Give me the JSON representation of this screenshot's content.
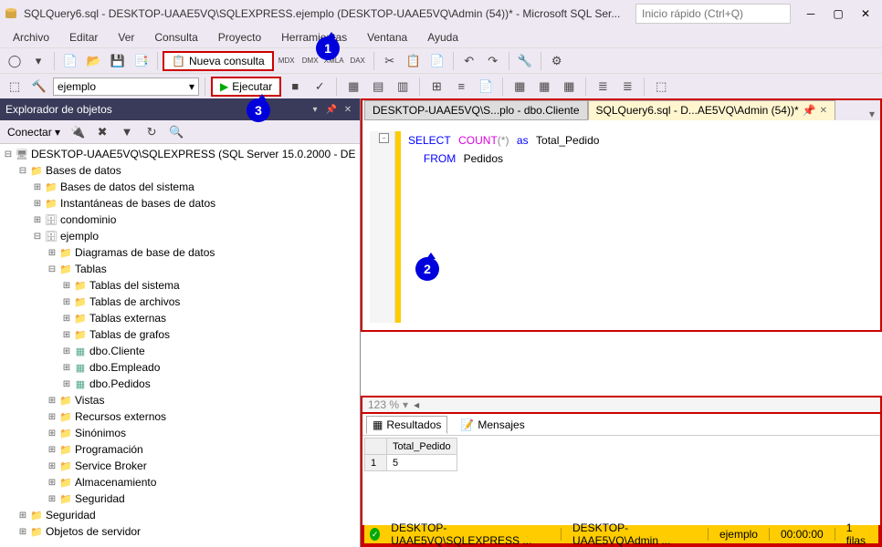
{
  "title": "SQLQuery6.sql - DESKTOP-UAAE5VQ\\SQLEXPRESS.ejemplo (DESKTOP-UAAE5VQ\\Admin (54))* - Microsoft SQL Ser...",
  "quick_launch_placeholder": "Inicio rápido (Ctrl+Q)",
  "menu": [
    "Archivo",
    "Editar",
    "Ver",
    "Consulta",
    "Proyecto",
    "Herramientas",
    "Ventana",
    "Ayuda"
  ],
  "toolbar1": {
    "nueva_consulta": "Nueva consulta"
  },
  "toolbar2": {
    "db": "ejemplo",
    "ejecutar": "Ejecutar"
  },
  "explorer": {
    "title": "Explorador de objetos",
    "conectar": "Conectar",
    "server": "DESKTOP-UAAE5VQ\\SQLEXPRESS (SQL Server 15.0.2000 - DE",
    "nodes": {
      "bases_de_datos": "Bases de datos",
      "bd_sistema": "Bases de datos del sistema",
      "instantaneas": "Instantáneas de bases de datos",
      "condominio": "condominio",
      "ejemplo": "ejemplo",
      "diagramas": "Diagramas de base de datos",
      "tablas": "Tablas",
      "tablas_sistema": "Tablas del sistema",
      "tablas_archivos": "Tablas de archivos",
      "tablas_externas": "Tablas externas",
      "tablas_grafos": "Tablas de grafos",
      "dbo_cliente": "dbo.Cliente",
      "dbo_empleado": "dbo.Empleado",
      "dbo_pedidos": "dbo.Pedidos",
      "vistas": "Vistas",
      "recursos_externos": "Recursos externos",
      "sinonimos": "Sinónimos",
      "programacion": "Programación",
      "service_broker": "Service Broker",
      "almacenamiento": "Almacenamiento",
      "seguridad": "Seguridad",
      "seguridad2": "Seguridad",
      "objetos_servidor": "Objetos de servidor"
    }
  },
  "tabs": {
    "inactive": "DESKTOP-UAAE5VQ\\S...plo - dbo.Cliente",
    "active": "SQLQuery6.sql - D...AE5VQ\\Admin (54))*"
  },
  "sql": {
    "line1_a": "SELECT",
    "line1_b": "COUNT",
    "line1_c": "(*)",
    "line1_d": "as",
    "line1_e": "Total_Pedido",
    "line2_a": "FROM",
    "line2_b": "Pedidos"
  },
  "zoom": "123 %",
  "results": {
    "tab_results": "Resultados",
    "tab_messages": "Mensajes",
    "col": "Total_Pedido",
    "row_num": "1",
    "value": "5"
  },
  "status": {
    "server": "DESKTOP-UAAE5VQ\\SQLEXPRESS ...",
    "user": "DESKTOP-UAAE5VQ\\Admin ...",
    "db": "ejemplo",
    "time": "00:00:00",
    "rows": "1 filas"
  },
  "callouts": {
    "c1": "1",
    "c2": "2",
    "c3": "3"
  }
}
